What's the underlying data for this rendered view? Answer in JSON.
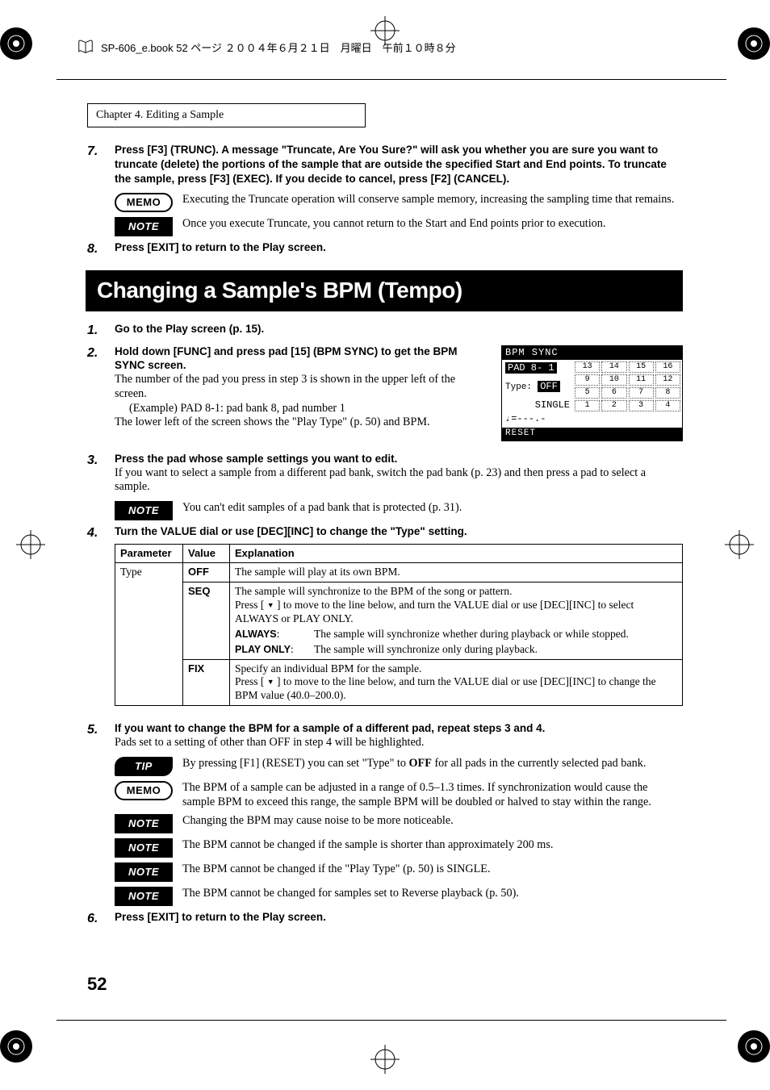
{
  "header": {
    "book_info": "SP-606_e.book  52 ページ  ２００４年６月２１日　月曜日　午前１０時８分"
  },
  "chapter": "Chapter 4. Editing a Sample",
  "step7": {
    "num": "7.",
    "bold": "Press [F3] (TRUNC). A message \"Truncate, Are You Sure?\" will ask you whether you are sure you want to truncate (delete) the portions of the sample that are outside the specified Start and End points. To truncate the sample, press [F3] (EXEC). If you decide to cancel, press [F2] (CANCEL)."
  },
  "memo1": "Executing the Truncate operation will conserve sample memory, increasing the sampling time that remains.",
  "note1": "Once you execute Truncate, you cannot return to the Start and End points prior to execution.",
  "step8": {
    "num": "8.",
    "bold": "Press [EXIT] to return to the Play screen."
  },
  "section_title": "Changing a Sample's BPM (Tempo)",
  "lcd": {
    "header": "BPM SYNC",
    "pad_line": "PAD  8- 1",
    "type_label": "Type:",
    "type_value": "OFF",
    "single": "SINGLE",
    "bpm_line": "♩=---.-",
    "pads": [
      "13",
      "14",
      "15",
      "16",
      "9",
      "10",
      "11",
      "12",
      "5",
      "6",
      "7",
      "8",
      "1",
      "2",
      "3",
      "4"
    ],
    "footer": "RESET"
  },
  "step1": {
    "num": "1.",
    "bold": "Go to the Play screen (p. 15)."
  },
  "step2": {
    "num": "2.",
    "bold": "Hold down [FUNC] and press pad [15] (BPM SYNC) to get the BPM SYNC screen.",
    "l1": "The number of the pad you press in step 3 is shown in the upper left of the screen.",
    "l2": "(Example) PAD 8-1: pad bank 8, pad number 1",
    "l3": "The lower left of the screen shows the \"Play Type\" (p. 50) and BPM."
  },
  "step3": {
    "num": "3.",
    "bold": "Press the pad whose sample settings you want to edit.",
    "l1": "If you want to select a sample from a different pad bank, switch the pad bank (p. 23) and then press a pad to select a sample."
  },
  "note2": "You can't edit samples of a pad bank that is protected (p. 31).",
  "step4": {
    "num": "4.",
    "bold": "Turn the VALUE dial or use [DEC][INC] to change the \"Type\" setting."
  },
  "table": {
    "h1": "Parameter",
    "h2": "Value",
    "h3": "Explanation",
    "param": "Type",
    "off": {
      "v": "OFF",
      "e": "The sample will play at its own BPM."
    },
    "seq": {
      "v": "SEQ",
      "e1": "The sample will synchronize to the BPM of the song or pattern.",
      "e2a": "Press [",
      "e2b": " ] to move to the line below, and turn the VALUE dial or use [DEC][INC] to select ALWAYS or PLAY ONLY.",
      "always_k": "ALWAYS",
      "always_v": "The sample will synchronize whether during playback or while stopped.",
      "playonly_k": "PLAY ONLY",
      "playonly_v": "The sample will synchronize only during playback."
    },
    "fix": {
      "v": "FIX",
      "e1": "Specify an individual BPM for the sample.",
      "e2a": "Press [",
      "e2b": " ] to move to the line below, and turn the VALUE dial or use [DEC][INC] to change the BPM value (40.0–200.0)."
    }
  },
  "step5": {
    "num": "5.",
    "bold": "If you want to change the BPM for a sample of a different pad, repeat steps 3 and 4.",
    "l1": "Pads set to a setting of other than OFF in step 4 will be highlighted."
  },
  "tip1a": "By pressing [F1] (RESET) you can set \"Type\" to ",
  "tip1b": "OFF",
  "tip1c": " for all pads in the currently selected pad bank.",
  "memo2": "The BPM of a sample can be adjusted in a range of 0.5–1.3 times. If synchronization would cause the sample BPM to exceed this range, the sample BPM will be doubled or halved to stay within the range.",
  "note3": "Changing the BPM may cause noise to be more noticeable.",
  "note4": "The BPM cannot be changed if the sample is shorter than approximately 200 ms.",
  "note5": "The BPM cannot be changed if the \"Play Type\" (p. 50) is SINGLE.",
  "note6": "The BPM cannot be changed for samples set to Reverse playback (p. 50).",
  "step6": {
    "num": "6.",
    "bold": "Press [EXIT] to return to the Play screen."
  },
  "page_num": "52",
  "badges": {
    "memo": "MEMO",
    "note": "NOTE",
    "tip": "TIP"
  }
}
